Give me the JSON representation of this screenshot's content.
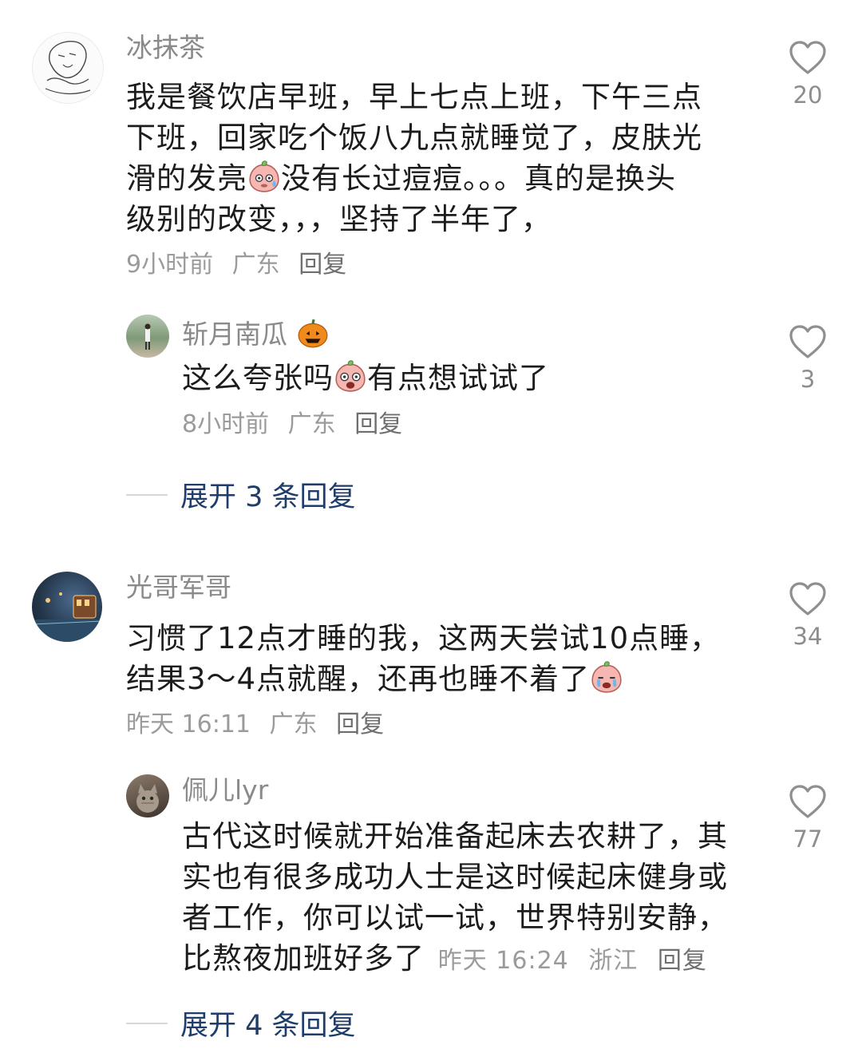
{
  "comments": [
    {
      "username": "冰抹茶",
      "text": [
        "我是餐饮店早班，早上七点上班，下午三点",
        "下班，回家吃个饭八九点就睡觉了，皮肤光",
        "滑的发亮",
        "没有长过痘痘。。。真的是换头",
        "级别的改变，，，坚持了半年了，"
      ],
      "time": "9小时前",
      "location": "广东",
      "reply_label": "回复",
      "likes": "20",
      "replies": [
        {
          "username": "斩月南瓜",
          "text_before": "这么夸张吗",
          "text_after": "有点想试试了",
          "time": "8小时前",
          "location": "广东",
          "reply_label": "回复",
          "likes": "3"
        }
      ],
      "expand_label": "展开 3 条回复"
    },
    {
      "username": "光哥军哥",
      "text": [
        "习惯了12点才睡的我，这两天尝试10点睡，",
        "结果3～4点就醒，还再也睡不着了"
      ],
      "time": "昨天 16:11",
      "location": "广东",
      "reply_label": "回复",
      "likes": "34",
      "replies": [
        {
          "username": "佩儿lyr",
          "text": [
            "古代这时候就开始准备起床去农耕了，其",
            "实也有很多成功人士是这时候起床健身或",
            "者工作，你可以试一试，世界特别安静，",
            "比熬夜加班好多了"
          ],
          "time": "昨天 16:24",
          "location": "浙江",
          "reply_label": "回复",
          "likes": "77"
        }
      ],
      "expand_label": "展开 4 条回复"
    }
  ],
  "colors": {
    "link": "#1f3d6b",
    "meta": "#9b9b9b",
    "name": "#8a8a8a"
  },
  "icons": [
    "heart-outline-icon",
    "sweat-face-emoji",
    "shocked-face-emoji",
    "crying-face-emoji",
    "pumpkin-emoji"
  ]
}
